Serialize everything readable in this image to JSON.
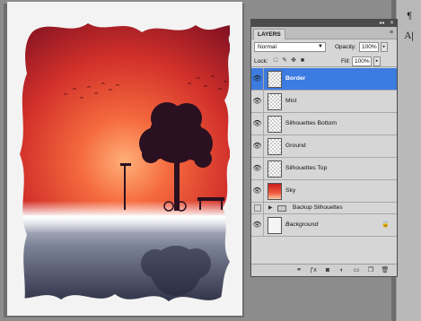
{
  "panel": {
    "tab_label": "LAYERS",
    "menu_glyph": "≡",
    "collapse_glyph": "◂◂",
    "close_glyph": "✕",
    "blend_mode": "Normal",
    "opacity_label": "Opacity:",
    "opacity_value": "100%",
    "lock_label": "Lock:",
    "fill_label": "Fill:",
    "fill_value": "100%"
  },
  "layers": [
    {
      "name": "Border",
      "visible": true,
      "selected": true,
      "thumb": "checker-icon"
    },
    {
      "name": "Mist",
      "visible": true,
      "selected": false,
      "thumb": "checker-icon"
    },
    {
      "name": "Silhouettes Bottom",
      "visible": true,
      "selected": false,
      "thumb": "checker-icon"
    },
    {
      "name": "Ground",
      "visible": true,
      "selected": false,
      "thumb": "checker-icon"
    },
    {
      "name": "Silhouettes Top",
      "visible": true,
      "selected": false,
      "thumb": "checker-icon"
    },
    {
      "name": "Sky",
      "visible": true,
      "selected": false,
      "thumb": "sky-thumbnail"
    },
    {
      "name": "Backup Silhouettes",
      "visible": false,
      "group": true
    },
    {
      "name": "Background",
      "visible": true,
      "locked": true,
      "thumb": "white-thumbnail"
    }
  ],
  "icons": {
    "eye": "eye-icon",
    "lock_transparent": "lock-transparent-icon",
    "lock_image": "brush-icon",
    "lock_position": "move-icon",
    "lock_all": "lock-icon",
    "footer": [
      "link-icon",
      "fx-icon",
      "mask-icon",
      "adjustment-icon",
      "folder-icon",
      "new-layer-icon",
      "trash-icon"
    ]
  },
  "right_strip": {
    "top_glyph": "¶",
    "bottom_glyph": "A|"
  },
  "colors": {
    "selection": "#3c7be0",
    "sky_top": "#8b0f1c",
    "sky_bottom": "#f35f3a"
  }
}
